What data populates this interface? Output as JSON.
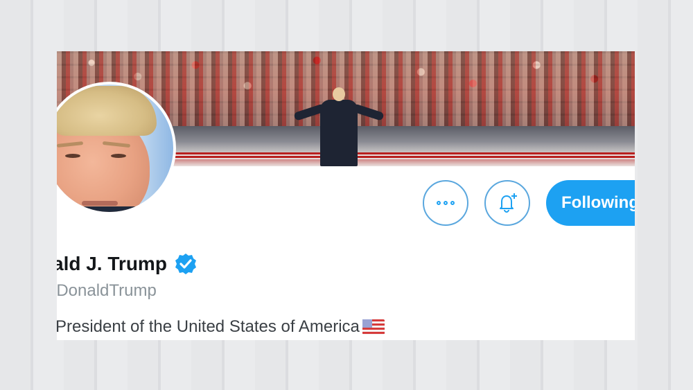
{
  "profile": {
    "name": "ald J. Trump",
    "handle": "lDonaldTrump",
    "bio": "President of the United States of America",
    "bio_emoji": "us-flag-icon",
    "verified": true
  },
  "actions": {
    "more_icon": "more-icon",
    "notify_icon": "bell-plus-icon",
    "following_label": "Following"
  },
  "colors": {
    "accent": "#1da1f2",
    "name": "#14171a",
    "handle": "#8a9399",
    "bio": "#3a3f44"
  }
}
